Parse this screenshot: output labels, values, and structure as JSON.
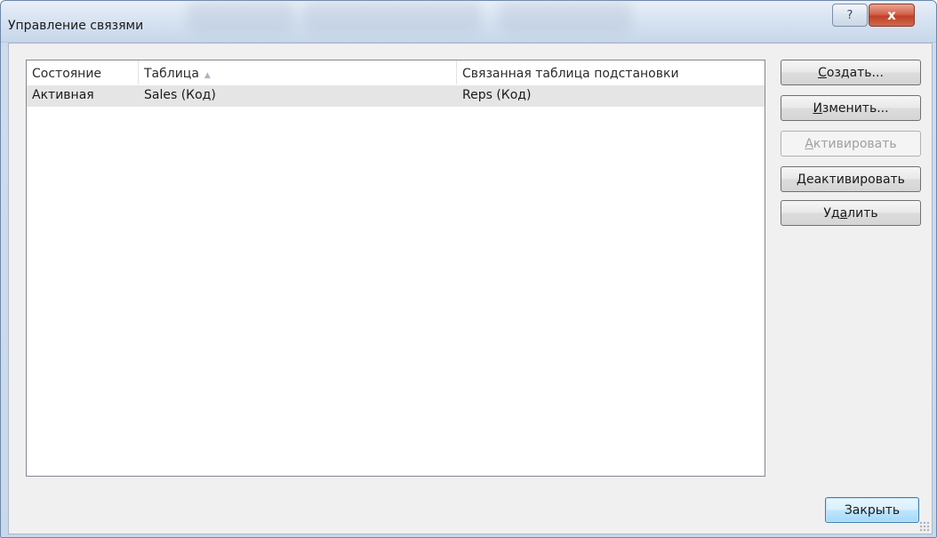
{
  "window": {
    "title": "Управление связями",
    "help_glyph": "?",
    "close_glyph": "x"
  },
  "table": {
    "columns": [
      "Состояние",
      "Таблица",
      "Связанная таблица подстановки"
    ],
    "sort_indicator": "▲",
    "rows": [
      {
        "status": "Активная",
        "table": "Sales (Код)",
        "lookup": "Reps (Код)"
      }
    ]
  },
  "buttons": {
    "create": {
      "accel": "С",
      "rest": "оздать..."
    },
    "edit": {
      "accel": "И",
      "rest": "зменить..."
    },
    "activate": {
      "accel": "А",
      "rest": "ктивировать"
    },
    "deactivate": {
      "accel": "Д",
      "rest": "еактивировать"
    },
    "delete": {
      "pre": "Уд",
      "accel": "а",
      "rest": "лить"
    },
    "close": "Закрыть"
  }
}
